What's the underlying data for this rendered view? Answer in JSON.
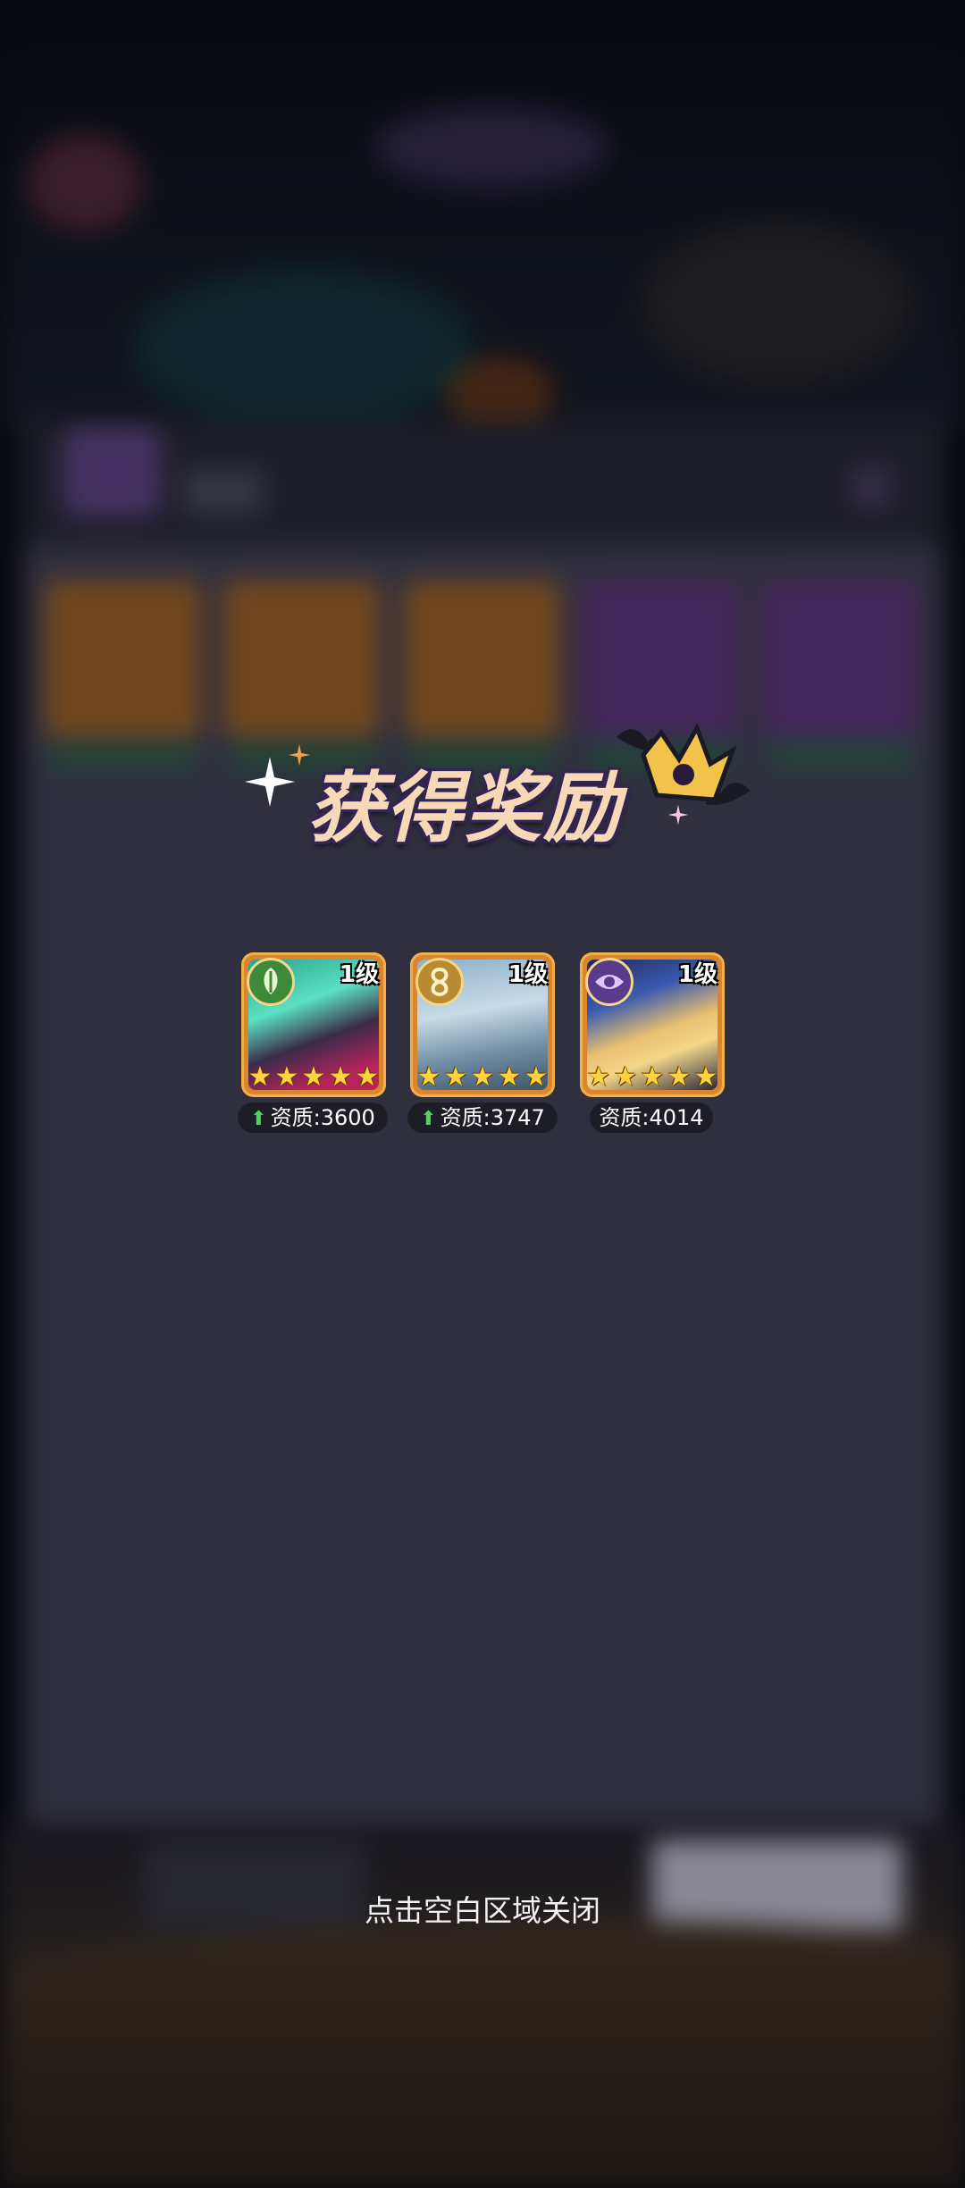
{
  "reward_popup": {
    "title": "获得奖励",
    "close_hint": "点击空白区域关闭",
    "heroes": [
      {
        "level": "1级",
        "stars": 5,
        "aptitude": "资质:3600",
        "aptitude_up": true,
        "faction_icon": "nature-leaf-icon"
      },
      {
        "level": "1级",
        "stars": 5,
        "aptitude": "资质:3747",
        "aptitude_up": true,
        "faction_icon": "infinity-icon"
      },
      {
        "level": "1级",
        "stars": 5,
        "aptitude": "资质:4014",
        "aptitude_up": false,
        "faction_icon": "eye-icon"
      }
    ]
  },
  "colors": {
    "title_text": "#f7d9b8",
    "title_outline": "#332452",
    "card_frame": "#d9862f",
    "star": "#ffd23f",
    "aptitude_arrow": "#4ad65a"
  }
}
